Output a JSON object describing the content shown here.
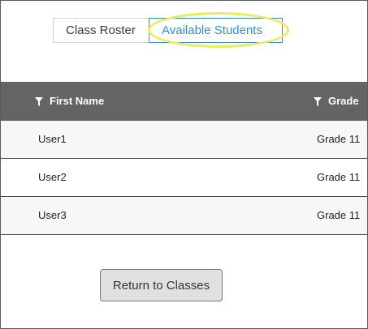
{
  "tabs": {
    "roster_label": "Class Roster",
    "available_label": "Available Students",
    "selected": "Available Students"
  },
  "table": {
    "headers": {
      "first_name": "First Name",
      "grade": "Grade"
    },
    "rows": [
      {
        "first_name": "User1",
        "grade": "Grade 11"
      },
      {
        "first_name": "User2",
        "grade": "Grade 11"
      },
      {
        "first_name": "User3",
        "grade": "Grade 11"
      }
    ]
  },
  "actions": {
    "return_label": "Return to Classes"
  },
  "icons": {
    "header_filter": "filter-icon"
  },
  "colors": {
    "accent": "#2f8fd6",
    "header_bg": "#646464",
    "highlight": "#ecec5a"
  }
}
